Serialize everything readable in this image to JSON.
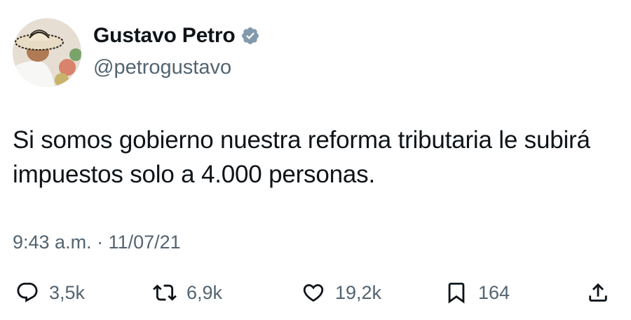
{
  "tweet": {
    "author": {
      "display_name": "Gustavo Petro",
      "handle": "@petrogustavo",
      "verified": true
    },
    "text": "Si somos gobierno nuestra reforma tributaria le subirá impuestos solo a 4.000 personas.",
    "timestamp": "9:43 a.m. · 11/07/21",
    "metrics": {
      "replies": "3,5k",
      "retweets": "6,9k",
      "likes": "19,2k",
      "bookmarks": "164"
    }
  },
  "icons": {
    "verified": "verified-badge-icon",
    "reply": "speech-bubble-icon",
    "retweet": "retweet-arrows-icon",
    "like": "heart-icon",
    "bookmark": "bookmark-icon",
    "share": "share-upload-icon"
  },
  "colors": {
    "text_primary": "#0f1419",
    "text_secondary": "#536471",
    "verified_badge": "#829aab",
    "background": "#ffffff"
  }
}
